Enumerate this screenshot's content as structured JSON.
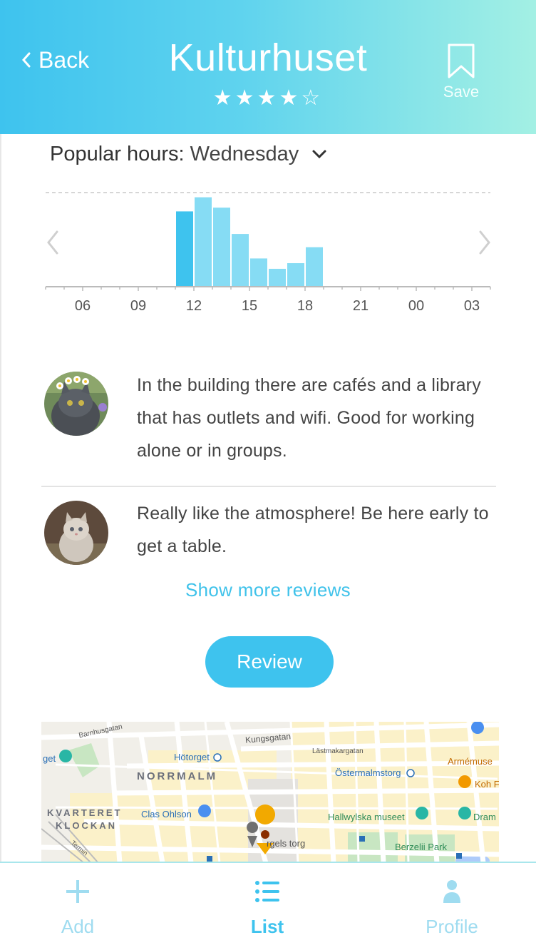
{
  "header": {
    "back_label": "Back",
    "title": "Kulturhuset",
    "rating": 4,
    "rating_max": 5,
    "save_label": "Save"
  },
  "popular_hours": {
    "label": "Popular hours:",
    "day": "Wednesday",
    "dropdown_icon": "chevron-down-icon",
    "prev_icon": "chevron-left-icon",
    "next_icon": "chevron-right-icon"
  },
  "chart_data": {
    "type": "bar",
    "x_ticks": [
      "06",
      "09",
      "12",
      "15",
      "18",
      "21",
      "00",
      "03"
    ],
    "hours": [
      11,
      12,
      13,
      14,
      15,
      16,
      17,
      18
    ],
    "values": [
      80,
      95,
      84,
      56,
      30,
      19,
      25,
      42
    ],
    "ylim": [
      0,
      100
    ],
    "highlighted_hour": 11,
    "colors": {
      "bar": "#86dcf4",
      "bar_current": "#3ec3ee",
      "axis": "#bbbbbb",
      "grid_dashed": "#d6d6d6"
    }
  },
  "reviews": [
    {
      "text": "In the building there are cafés and a library that has outlets and wifi. Good for working alone or in groups.",
      "avatar": "cat-with-flower-crown-avatar"
    },
    {
      "text": "Really like the atmosphere! Be here early to get a table.",
      "avatar": "kitten-avatar"
    }
  ],
  "show_more_label": "Show more reviews",
  "review_button_label": "Review",
  "map": {
    "labels": {
      "barnhusgatan": "Barnhusgatan",
      "kungsgatan": "Kungsgatan",
      "get": "get",
      "hotorget": "Hötorget",
      "lastmakargatan": "Lästmakargatan",
      "armemuseum": "Armémuse",
      "normalm": "NORRMALM",
      "ostermalmstorg": "Östermalmstorg",
      "kohf": "Koh F",
      "kvarteret": "KVARTERET",
      "klockan": "KLOCKAN",
      "clas_ohlson": "Clas Ohlson",
      "hallwylska": "Hallwylska museet",
      "drama": "Dram",
      "sergels_torg": "rgels torg",
      "berzelii": "Berzelii Park",
      "terminal": "Termin"
    }
  },
  "bottom_nav": {
    "add_label": "Add",
    "list_label": "List",
    "profile_label": "Profile"
  },
  "colors": {
    "accent": "#3ec3ee",
    "header_gradient_start": "#3ec3ee",
    "header_gradient_end": "#a3f0e4",
    "inactive_nav": "#9fdcf0"
  }
}
